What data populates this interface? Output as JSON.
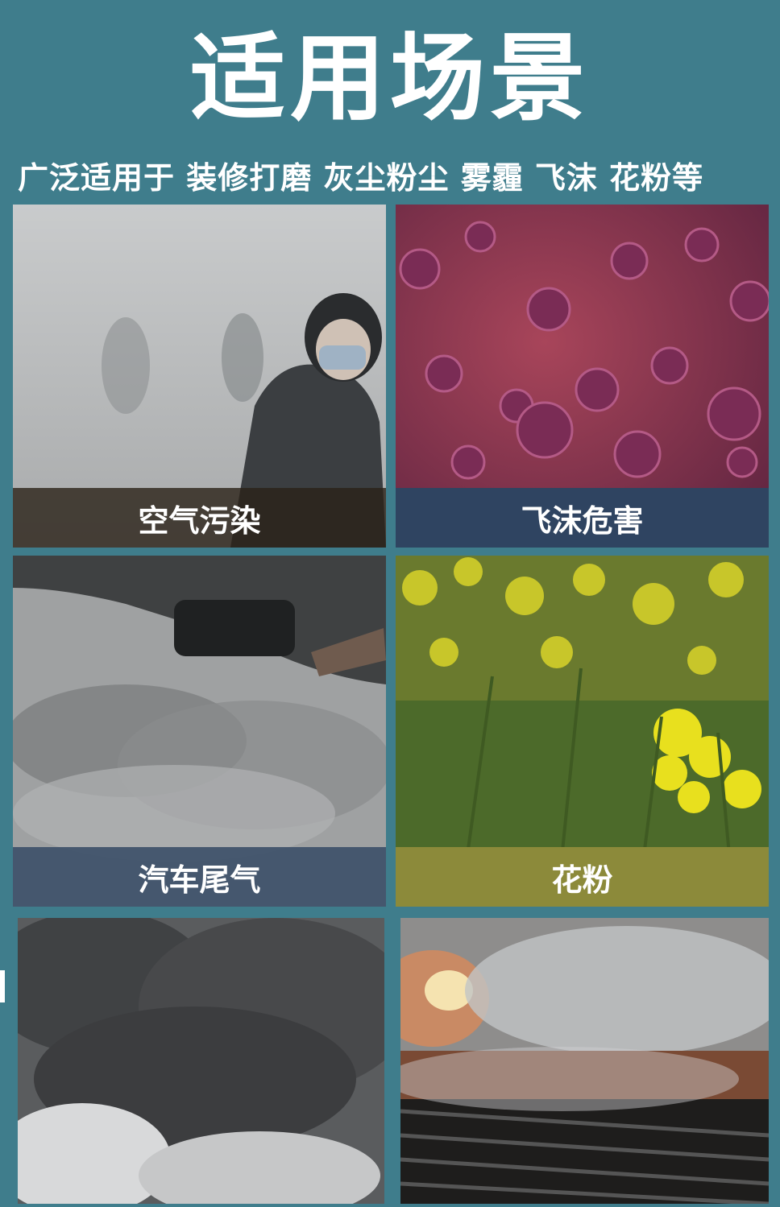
{
  "header": {
    "title": "适用场景",
    "subtitle": "广泛适用于  装修打磨  灰尘粉尘  雾霾  飞沫  花粉等"
  },
  "scenes": [
    {
      "caption": "空气污染"
    },
    {
      "caption": "飞沫危害"
    },
    {
      "caption": "汽车尾气"
    },
    {
      "caption": "花粉"
    },
    {
      "caption": ""
    },
    {
      "caption": ""
    }
  ]
}
